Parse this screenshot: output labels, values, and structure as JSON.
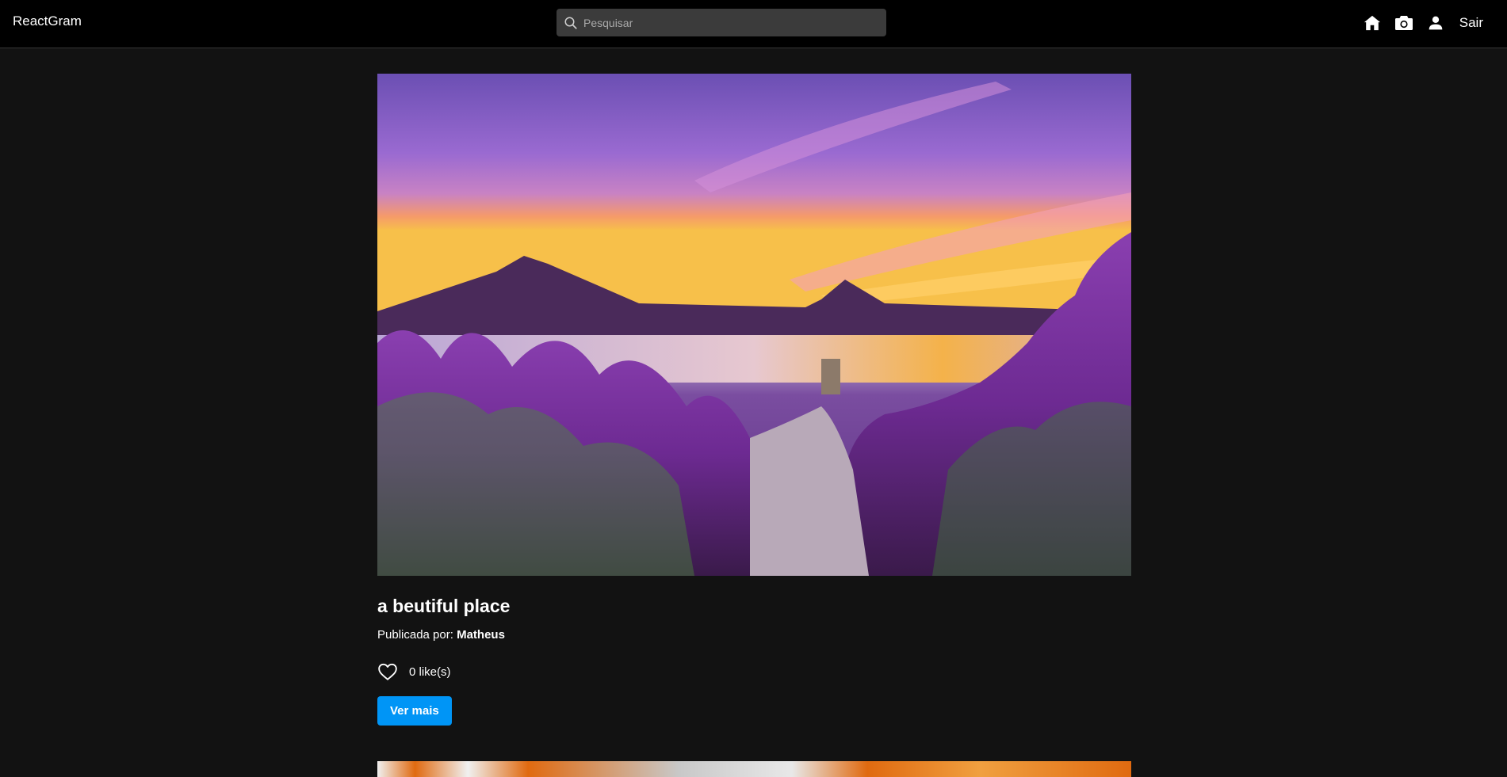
{
  "app": {
    "brand": "ReactGram"
  },
  "search": {
    "placeholder": "Pesquisar"
  },
  "nav": {
    "icons": [
      "home-icon",
      "camera-icon",
      "user-icon"
    ],
    "logout_label": "Sair"
  },
  "post": {
    "title": "a beutiful place",
    "published_by_label": "Publicada por:",
    "author": "Matheus",
    "likes_text": "0 like(s)",
    "see_more_label": "Ver mais"
  },
  "colors": {
    "navbar_bg": "#000000",
    "page_bg": "#121212",
    "search_bg": "#3b3b3b",
    "button_bg": "#0095f6"
  }
}
